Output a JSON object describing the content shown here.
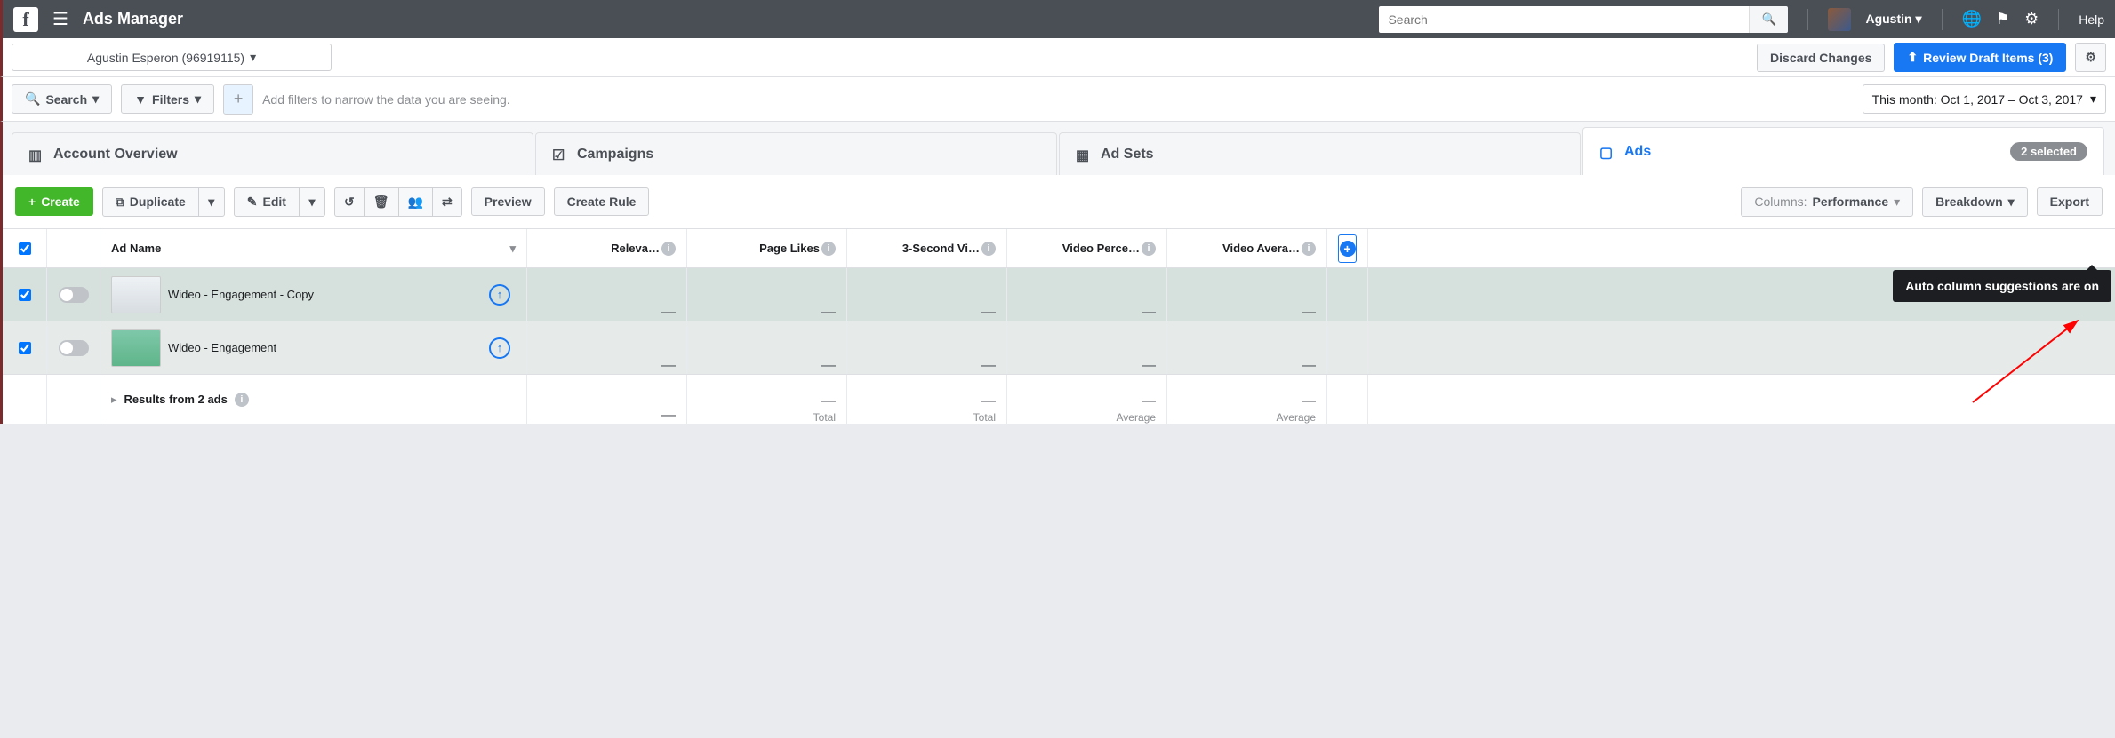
{
  "topnav": {
    "app_title": "Ads Manager",
    "search_placeholder": "Search",
    "user_name": "Agustin",
    "help": "Help"
  },
  "account_bar": {
    "account_label": "Agustin Esperon (96919115)",
    "discard": "Discard Changes",
    "review": "Review Draft Items (3)"
  },
  "filter_bar": {
    "search": "Search",
    "filters": "Filters",
    "hint": "Add filters to narrow the data you are seeing.",
    "date_range": "This month: Oct 1, 2017 – Oct 3, 2017"
  },
  "tabs": {
    "overview": "Account Overview",
    "campaigns": "Campaigns",
    "adsets": "Ad Sets",
    "ads": "Ads",
    "selected_badge": "2 selected"
  },
  "toolbar": {
    "create": "Create",
    "duplicate": "Duplicate",
    "edit": "Edit",
    "preview": "Preview",
    "create_rule": "Create Rule",
    "columns_prefix": "Columns:",
    "columns_value": "Performance",
    "breakdown": "Breakdown",
    "export": "Export"
  },
  "table": {
    "headers": {
      "name": "Ad Name",
      "relevance": "Releva…",
      "page_likes": "Page Likes",
      "three_sec": "3-Second Vi…",
      "vid_perc": "Video Perce…",
      "vid_avg": "Video Avera…"
    },
    "rows": [
      {
        "name": "Wideo - Engagement - Copy",
        "relevance": "—",
        "page_likes": "—",
        "three_sec": "—",
        "vid_perc": "—",
        "vid_avg": "—"
      },
      {
        "name": "Wideo - Engagement",
        "relevance": "—",
        "page_likes": "—",
        "three_sec": "—",
        "vid_perc": "—",
        "vid_avg": "—"
      }
    ],
    "footer": {
      "label": "Results from 2 ads",
      "relevance": "—",
      "page_likes": "—",
      "page_likes_sub": "Total",
      "three_sec": "—",
      "three_sec_sub": "Total",
      "vid_perc": "—",
      "vid_perc_sub": "Average",
      "vid_avg": "—",
      "vid_avg_sub": "Average"
    },
    "tooltip": "Auto column suggestions are on"
  }
}
